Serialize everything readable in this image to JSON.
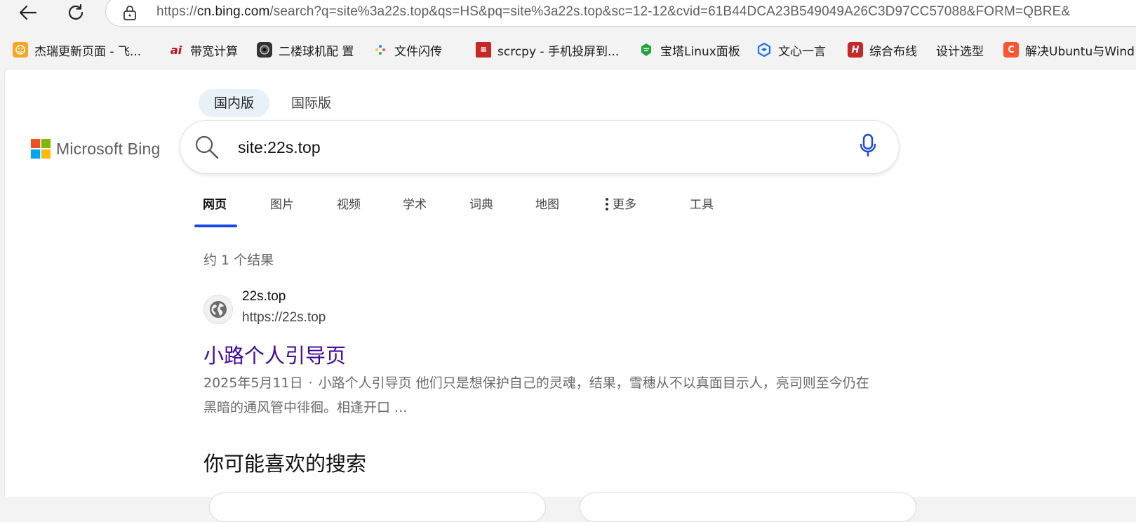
{
  "browser": {
    "url_host_prefix": "https://",
    "url_host": "cn.bing.com",
    "url_rest": "/search?q=site%3a22s.top&qs=HS&pq=site%3a22s.top&sc=12-12&cvid=61B44DCA23B549049A26C3D97CC57088&FORM=QBRE&",
    "bookmarks": [
      {
        "label": "杰瑞更新页面 - 飞...",
        "icon": "app-icon",
        "color": "#f5a623"
      },
      {
        "label": "带宽计算",
        "icon": "brand-logo-icon",
        "color": "#d0021b"
      },
      {
        "label": "二楼球机配 置",
        "icon": "camera-icon",
        "color": "#333333"
      },
      {
        "label": "文件闪传",
        "icon": "pinwheel-icon",
        "color": "#2f80ed"
      },
      {
        "label": "scrcpy - 手机投屏到...",
        "icon": "seal-icon",
        "color": "#c62828"
      },
      {
        "label": "宝塔Linux面板",
        "icon": "pagoda-icon",
        "color": "#20a53a"
      },
      {
        "label": "文心一言",
        "icon": "cube-icon",
        "color": "#1e6fff"
      },
      {
        "label": "综合布线",
        "icon": "h-letter-icon",
        "color": "#c62828"
      },
      {
        "label": "设计选型",
        "icon": "",
        "color": ""
      },
      {
        "label": "解决Ubuntu与Wind",
        "icon": "c-letter-icon",
        "color": "#fc5531"
      }
    ]
  },
  "scope_tabs": [
    {
      "label": "国内版",
      "active": true
    },
    {
      "label": "国际版",
      "active": false
    }
  ],
  "brand": {
    "name": "Microsoft Bing",
    "colors": [
      "#f25022",
      "#7fba00",
      "#00a4ef",
      "#ffb900"
    ]
  },
  "search": {
    "value": "site:22s.top"
  },
  "vertical_tabs": [
    {
      "label": "网页",
      "active": true
    },
    {
      "label": "图片",
      "active": false
    },
    {
      "label": "视频",
      "active": false
    },
    {
      "label": "学术",
      "active": false
    },
    {
      "label": "词典",
      "active": false
    },
    {
      "label": "地图",
      "active": false
    },
    {
      "label": "更多",
      "active": false
    },
    {
      "label": "工具",
      "active": false
    }
  ],
  "results": {
    "count_text": "约 1 个结果",
    "items": [
      {
        "site_name": "22s.top",
        "site_url": "https://22s.top",
        "title": "小路个人引导页",
        "date": "2025年5月11日",
        "separator": "·",
        "snippet": "小路个人引导页 他们只是想保护自己的灵魂，结果，雪穗从不以真面目示人，亮司则至今仍在黑暗的通风管中徘徊。相逢开口 ..."
      }
    ]
  },
  "related": {
    "heading": "你可能喜欢的搜索"
  },
  "accent_color": "#174ae4",
  "link_color": "#4007a2"
}
